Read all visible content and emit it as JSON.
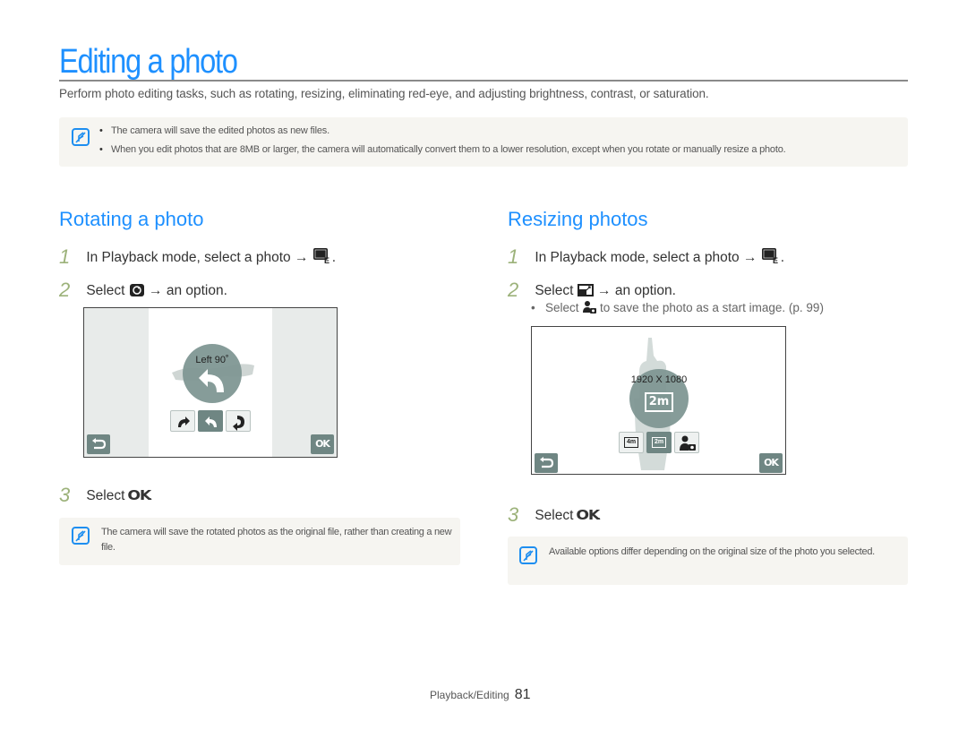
{
  "page": {
    "title": "Editing a photo",
    "intro": "Perform photo editing tasks, such as rotating, resizing, eliminating red-eye, and adjusting brightness, contrast, or saturation.",
    "accent_color": "#1e90ff",
    "step_number_color": "#9cb27a"
  },
  "top_note": {
    "icon": "note-icon",
    "bullets": [
      "The camera will save the edited photos as new files.",
      "When you edit photos that are 8MB or larger, the camera will automatically convert them to a lower resolution, except when you rotate or manually resize a photo."
    ]
  },
  "rotating": {
    "title": "Rotating a photo",
    "steps": [
      {
        "num": "1",
        "text_before": "In Playback mode, select a photo →",
        "icon": "edit-mode-icon",
        "text_after": "."
      },
      {
        "num": "2",
        "text_before": "Select",
        "icon": "rotate-icon",
        "text_after": "→ an option."
      },
      {
        "num": "3",
        "text_before": "Select",
        "icon": "ok-icon",
        "icon_text": "OK",
        "text_after": "."
      }
    ],
    "screen": {
      "label": "Left 90˚",
      "options": [
        "rotate-right-icon",
        "rotate-left-icon",
        "rotate-180-icon"
      ],
      "selected_option": 1,
      "back_icon": "back-icon",
      "ok_label": "OK"
    },
    "note": "The camera will save the rotated photos as the original file, rather than creating a new file."
  },
  "resizing": {
    "title": "Resizing photos",
    "steps": [
      {
        "num": "1",
        "text_before": "In Playback mode, select a photo →",
        "icon": "edit-mode-icon",
        "text_after": "."
      },
      {
        "num": "2",
        "text_before": "Select",
        "icon": "resize-icon",
        "text_after": "→ an option."
      },
      {
        "num": "3",
        "text_before": "Select",
        "icon": "ok-icon",
        "icon_text": "OK",
        "text_after": "."
      }
    ],
    "sub_bullet": {
      "text_before": "Select",
      "icon": "start-image-icon",
      "text_after": "to save the photo as a start image. (p. 99)"
    },
    "screen": {
      "label": "1920 X 1080",
      "center_icon_text": "2m",
      "options": [
        "size-4m-icon",
        "size-2m-icon",
        "start-image-icon"
      ],
      "option_texts": [
        "4m",
        "2m",
        ""
      ],
      "selected_option": 1,
      "back_icon": "back-icon",
      "ok_label": "OK"
    },
    "note": "Available options differ depending on the original size of the photo you selected."
  },
  "footer": {
    "section": "Playback/Editing",
    "page_number": "81"
  }
}
